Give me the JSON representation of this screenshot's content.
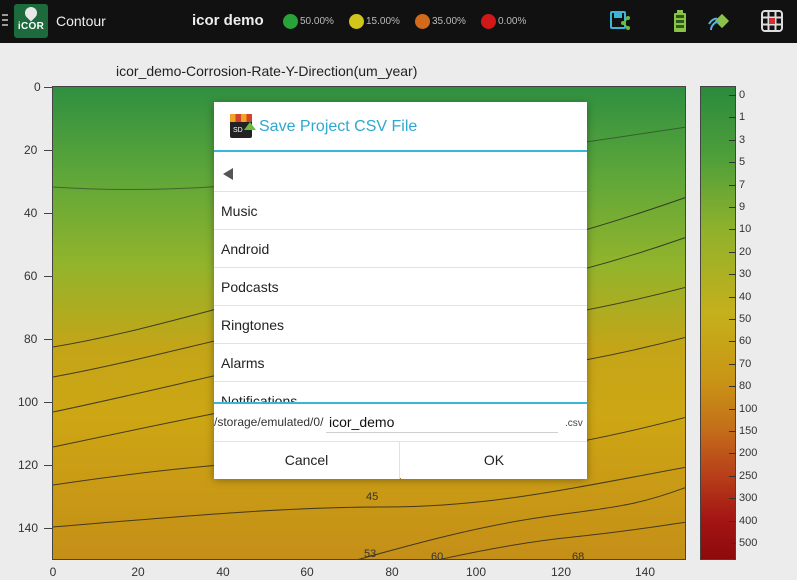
{
  "topbar": {
    "app_title": "Contour",
    "project_name": "icor demo",
    "logo_text": "iCOR",
    "stats": [
      {
        "value": "50.00%",
        "color": "#27a33a"
      },
      {
        "value": "15.00%",
        "color": "#d1c41a"
      },
      {
        "value": "35.00%",
        "color": "#d26a1b"
      },
      {
        "value": "0.00%",
        "color": "#d11818"
      }
    ],
    "icons": [
      "save-share-icon",
      "battery-icon",
      "signal-icon",
      "grid-app-icon"
    ]
  },
  "plot": {
    "title": "icor_demo-Corrosion-Rate-Y-Direction(um_year)",
    "y_ticks": [
      "0",
      "20",
      "40",
      "60",
      "80",
      "100",
      "120",
      "140"
    ],
    "x_ticks": [
      "0",
      "20",
      "40",
      "60",
      "80",
      "100",
      "120",
      "140"
    ],
    "contour_labels": [
      "45",
      "53",
      "60",
      "68"
    ]
  },
  "colorbar": {
    "labels": [
      "0",
      "1",
      "3",
      "5",
      "7",
      "9",
      "10",
      "20",
      "30",
      "40",
      "50",
      "60",
      "70",
      "80",
      "100",
      "150",
      "200",
      "250",
      "300",
      "400",
      "500"
    ]
  },
  "dialog": {
    "title": "Save Project CSV File",
    "icon_text": "SD",
    "items": [
      "Music",
      "Android",
      "Podcasts",
      "Ringtones",
      "Alarms",
      "Notifications"
    ],
    "path_prefix": "/storage/emulated/0/",
    "filename": "icor_demo",
    "extension": ".csv",
    "cancel_label": "Cancel",
    "ok_label": "OK"
  }
}
